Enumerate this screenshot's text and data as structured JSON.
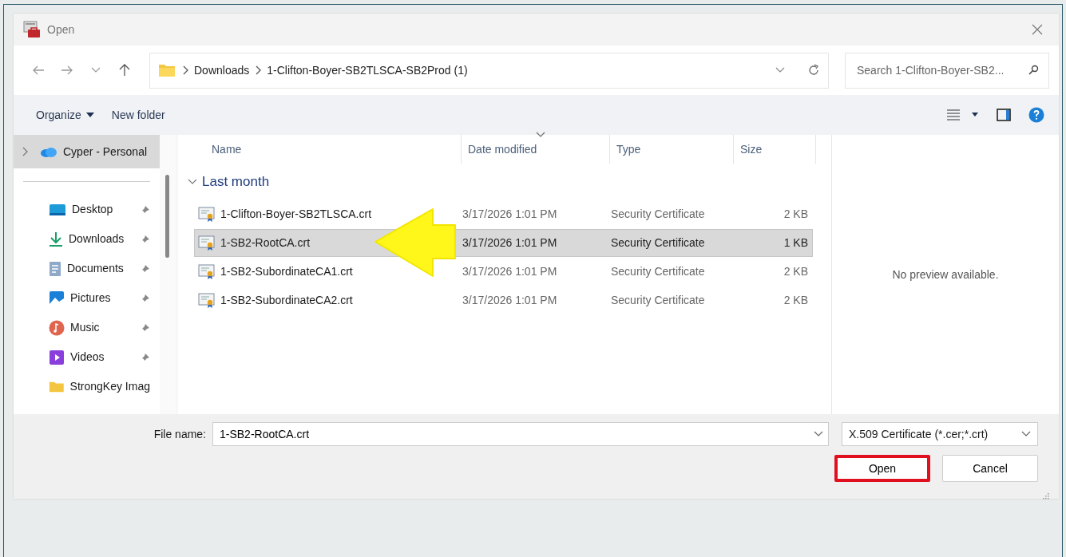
{
  "window": {
    "title": "Open"
  },
  "address": {
    "breadcrumb": [
      "Downloads",
      "1-Clifton-Boyer-SB2TLSCA-SB2Prod (1)"
    ],
    "search": {
      "placeholder": "Search 1-Clifton-Boyer-SB2..."
    }
  },
  "toolbar": {
    "organize": "Organize",
    "new_folder": "New folder"
  },
  "sidebar": {
    "items": [
      {
        "kind": "cloud",
        "label": "Cyper - Personal",
        "selected": true,
        "expanded": false,
        "pinned": false
      },
      {
        "kind": "desktop",
        "label": "Desktop",
        "selected": false,
        "pinned": true
      },
      {
        "kind": "downloads",
        "label": "Downloads",
        "selected": false,
        "pinned": true
      },
      {
        "kind": "documents",
        "label": "Documents",
        "selected": false,
        "pinned": true
      },
      {
        "kind": "pictures",
        "label": "Pictures",
        "selected": false,
        "pinned": true
      },
      {
        "kind": "music",
        "label": "Music",
        "selected": false,
        "pinned": true
      },
      {
        "kind": "videos",
        "label": "Videos",
        "selected": false,
        "pinned": true
      },
      {
        "kind": "folder",
        "label": "StrongKey Imag",
        "selected": false,
        "pinned": false
      }
    ]
  },
  "file_list": {
    "columns": [
      {
        "label": "Name",
        "sorted": false
      },
      {
        "label": "Date modified",
        "sorted": true
      },
      {
        "label": "Type",
        "sorted": false
      },
      {
        "label": "Size",
        "sorted": false
      }
    ],
    "groups": [
      {
        "label": "Last month",
        "expanded": true,
        "files": [
          {
            "name": "1-Clifton-Boyer-SB2TLSCA.crt",
            "date": "3/17/2026 1:01 PM",
            "type": "Security Certificate",
            "size": "2 KB",
            "selected": false
          },
          {
            "name": "1-SB2-RootCA.crt",
            "date": "3/17/2026 1:01 PM",
            "type": "Security Certificate",
            "size": "1 KB",
            "selected": true
          },
          {
            "name": "1-SB2-SubordinateCA1.crt",
            "date": "3/17/2026 1:01 PM",
            "type": "Security Certificate",
            "size": "2 KB",
            "selected": false
          },
          {
            "name": "1-SB2-SubordinateCA2.crt",
            "date": "3/17/2026 1:01 PM",
            "type": "Security Certificate",
            "size": "2 KB",
            "selected": false
          }
        ]
      }
    ]
  },
  "preview": {
    "message": "No preview available."
  },
  "footer": {
    "file_name_label": "File name:",
    "file_name": "1-SB2-RootCA.crt",
    "filter": "X.509 Certificate (*.cer;*.crt)",
    "buttons": [
      {
        "label": "Open",
        "highlighted": true
      },
      {
        "label": "Cancel",
        "highlighted": false
      }
    ]
  }
}
